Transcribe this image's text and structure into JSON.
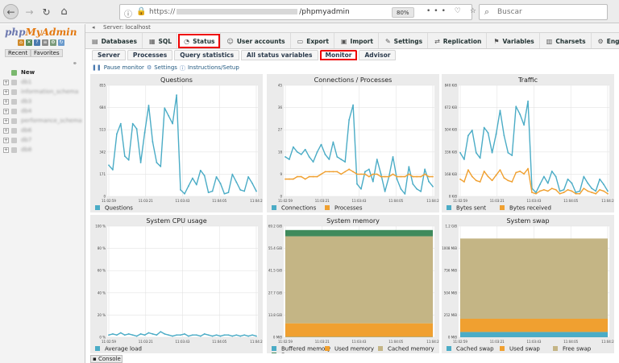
{
  "browser": {
    "url_scheme": "https://",
    "url_path": "/phpmyadmin",
    "zoom": "80%",
    "url_actions": "•••",
    "search_placeholder": "Buscar"
  },
  "sidebar": {
    "logo": {
      "php": "php",
      "my": "My",
      "admin": "Admin"
    },
    "recent": "Recent",
    "favorites": "Favorites",
    "new_label": "New",
    "databases": [
      "db1",
      "information_schema",
      "db3",
      "db4",
      "performance_schema",
      "db6",
      "db7",
      "db8"
    ]
  },
  "breadcrumb": {
    "server": "Server: localhost"
  },
  "top_tabs": [
    {
      "label": "Databases",
      "icon": "db-icon"
    },
    {
      "label": "SQL",
      "icon": "sql-icon"
    },
    {
      "label": "Status",
      "icon": "status-icon",
      "active": true
    },
    {
      "label": "User accounts",
      "icon": "users-icon"
    },
    {
      "label": "Export",
      "icon": "export-icon"
    },
    {
      "label": "Import",
      "icon": "import-icon"
    },
    {
      "label": "Settings",
      "icon": "wrench-icon"
    },
    {
      "label": "Replication",
      "icon": "replication-icon"
    },
    {
      "label": "Variables",
      "icon": "variables-icon"
    },
    {
      "label": "Charsets",
      "icon": "charsets-icon"
    },
    {
      "label": "Engines",
      "icon": "engines-icon"
    }
  ],
  "sub_tabs": [
    {
      "label": "Server"
    },
    {
      "label": "Processes"
    },
    {
      "label": "Query statistics"
    },
    {
      "label": "All status variables"
    },
    {
      "label": "Monitor",
      "active": true
    },
    {
      "label": "Advisor"
    }
  ],
  "toolbar": {
    "pause": "Pause monitor",
    "settings": "Settings",
    "instructions": "Instructions/Setup"
  },
  "console": "Console",
  "colors": {
    "teal": "#4bacc6",
    "orange": "#f0a030",
    "tan": "#c4b585",
    "green": "#3f8a5c",
    "grid": "#e3e3e3",
    "panel_bg": "#ebebeb"
  },
  "chart_data": [
    {
      "type": "line",
      "title": "Questions",
      "x_ticks": [
        "11:02:59",
        "11:03:21",
        "11:03:43",
        "11:04:05",
        "11:04:2"
      ],
      "y_ticks": [
        "855",
        "684",
        "513",
        "342",
        "171",
        "0"
      ],
      "ylim": [
        0,
        855
      ],
      "series": [
        {
          "name": "Questions",
          "color": "#4bacc6",
          "values": [
            240,
            205,
            480,
            560,
            310,
            280,
            560,
            520,
            260,
            490,
            700,
            420,
            260,
            230,
            680,
            620,
            560,
            780,
            50,
            20,
            80,
            140,
            90,
            200,
            160,
            30,
            40,
            150,
            100,
            20,
            30,
            170,
            110,
            50,
            40,
            150,
            100,
            40
          ]
        }
      ]
    },
    {
      "type": "line",
      "title": "Connections / Processes",
      "x_ticks": [
        "11:02:59",
        "11:03:21",
        "11:03:43",
        "11:04:05",
        "11:04:2"
      ],
      "y_ticks": [
        "45",
        "36",
        "27",
        "18",
        "9",
        "0"
      ],
      "ylim": [
        0,
        45
      ],
      "series": [
        {
          "name": "Connections",
          "color": "#4bacc6",
          "values": [
            16,
            15,
            20,
            18,
            17,
            19,
            16,
            14,
            18,
            21,
            17,
            15,
            22,
            16,
            15,
            14,
            31,
            37,
            5,
            3,
            10,
            11,
            6,
            15,
            9,
            2,
            8,
            16,
            7,
            3,
            1,
            12,
            5,
            3,
            2,
            11,
            6,
            4
          ]
        },
        {
          "name": "Processes",
          "color": "#f0a030",
          "values": [
            7,
            7,
            7,
            8,
            8,
            7,
            8,
            8,
            8,
            9,
            10,
            10,
            10,
            10,
            9,
            10,
            11,
            10,
            9,
            9,
            9,
            8,
            9,
            9,
            8,
            8,
            8,
            9,
            8,
            8,
            8,
            9,
            8,
            8,
            8,
            9,
            8,
            8
          ]
        }
      ]
    },
    {
      "type": "line",
      "title": "Traffic",
      "x_ticks": [
        "11:02:59",
        "11:03:21",
        "11:03:43",
        "11:04:05",
        "11:04:2"
      ],
      "y_ticks": [
        "840 KiB",
        "672 KiB",
        "504 KiB",
        "336 KiB",
        "168 KiB",
        "0 KiB"
      ],
      "ylim": [
        0,
        840
      ],
      "series": [
        {
          "name": "Bytes sent",
          "color": "#4bacc6",
          "values": [
            330,
            280,
            460,
            500,
            330,
            290,
            520,
            480,
            330,
            470,
            650,
            460,
            330,
            310,
            680,
            620,
            540,
            720,
            60,
            30,
            90,
            150,
            100,
            190,
            150,
            40,
            50,
            130,
            100,
            30,
            40,
            150,
            100,
            60,
            40,
            130,
            90,
            40
          ]
        },
        {
          "name": "Bytes received",
          "color": "#f0a030",
          "values": [
            130,
            110,
            200,
            150,
            120,
            110,
            190,
            150,
            120,
            160,
            200,
            140,
            120,
            110,
            180,
            190,
            170,
            210,
            30,
            20,
            40,
            50,
            40,
            60,
            50,
            20,
            30,
            50,
            40,
            20,
            20,
            60,
            40,
            30,
            20,
            50,
            40,
            20
          ]
        }
      ]
    },
    {
      "type": "line",
      "title": "System CPU usage",
      "x_ticks": [
        "11:02:59",
        "11:03:21",
        "11:03:43",
        "11:04:05",
        "11:04:2"
      ],
      "y_ticks": [
        "100 %",
        "80 %",
        "60 %",
        "40 %",
        "20 %",
        "0 %"
      ],
      "ylim": [
        0,
        100
      ],
      "series": [
        {
          "name": "Average load",
          "color": "#4bacc6",
          "values": [
            2,
            3,
            2,
            4,
            2,
            3,
            2,
            1,
            3,
            2,
            4,
            3,
            2,
            5,
            3,
            2,
            1,
            2,
            2,
            3,
            1,
            2,
            2,
            1,
            3,
            2,
            1,
            2,
            1,
            2,
            2,
            1,
            2,
            1,
            2,
            1,
            2,
            1
          ]
        }
      ]
    },
    {
      "type": "area",
      "title": "System memory",
      "x_ticks": [
        "11:02:59",
        "11:03:21",
        "11:03:43",
        "11:04:05",
        "11:04:2"
      ],
      "y_ticks": [
        "69.2 GiB",
        "55.4 GiB",
        "41.5 GiB",
        "27.7 GiB",
        "13.8 GiB",
        "0 MiB"
      ],
      "ylim": [
        0,
        69.2
      ],
      "stacked": true,
      "series": [
        {
          "name": "Buffered memory",
          "color": "#4bacc6",
          "value": 0.2
        },
        {
          "name": "Used memory",
          "color": "#f0a030",
          "value": 8.5
        },
        {
          "name": "Cached memory",
          "color": "#c4b585",
          "value": 54.2
        },
        {
          "name": "Free memory",
          "color": "#3f8a5c",
          "value": 3.9
        }
      ]
    },
    {
      "type": "area",
      "title": "System swap",
      "x_ticks": [
        "11:02:59",
        "11:03:21",
        "11:03:43",
        "11:04:05",
        "11:04:2"
      ],
      "y_ticks": [
        "1.2 GiB",
        "1008 MiB",
        "756 MiB",
        "504 MiB",
        "252 MiB",
        "0 MiB"
      ],
      "ylim": [
        0,
        1260
      ],
      "stacked": true,
      "series": [
        {
          "name": "Cached swap",
          "color": "#4bacc6",
          "value": 60
        },
        {
          "name": "Used swap",
          "color": "#f0a030",
          "value": 150
        },
        {
          "name": "Free swap",
          "color": "#c4b585",
          "value": 910
        }
      ]
    }
  ]
}
